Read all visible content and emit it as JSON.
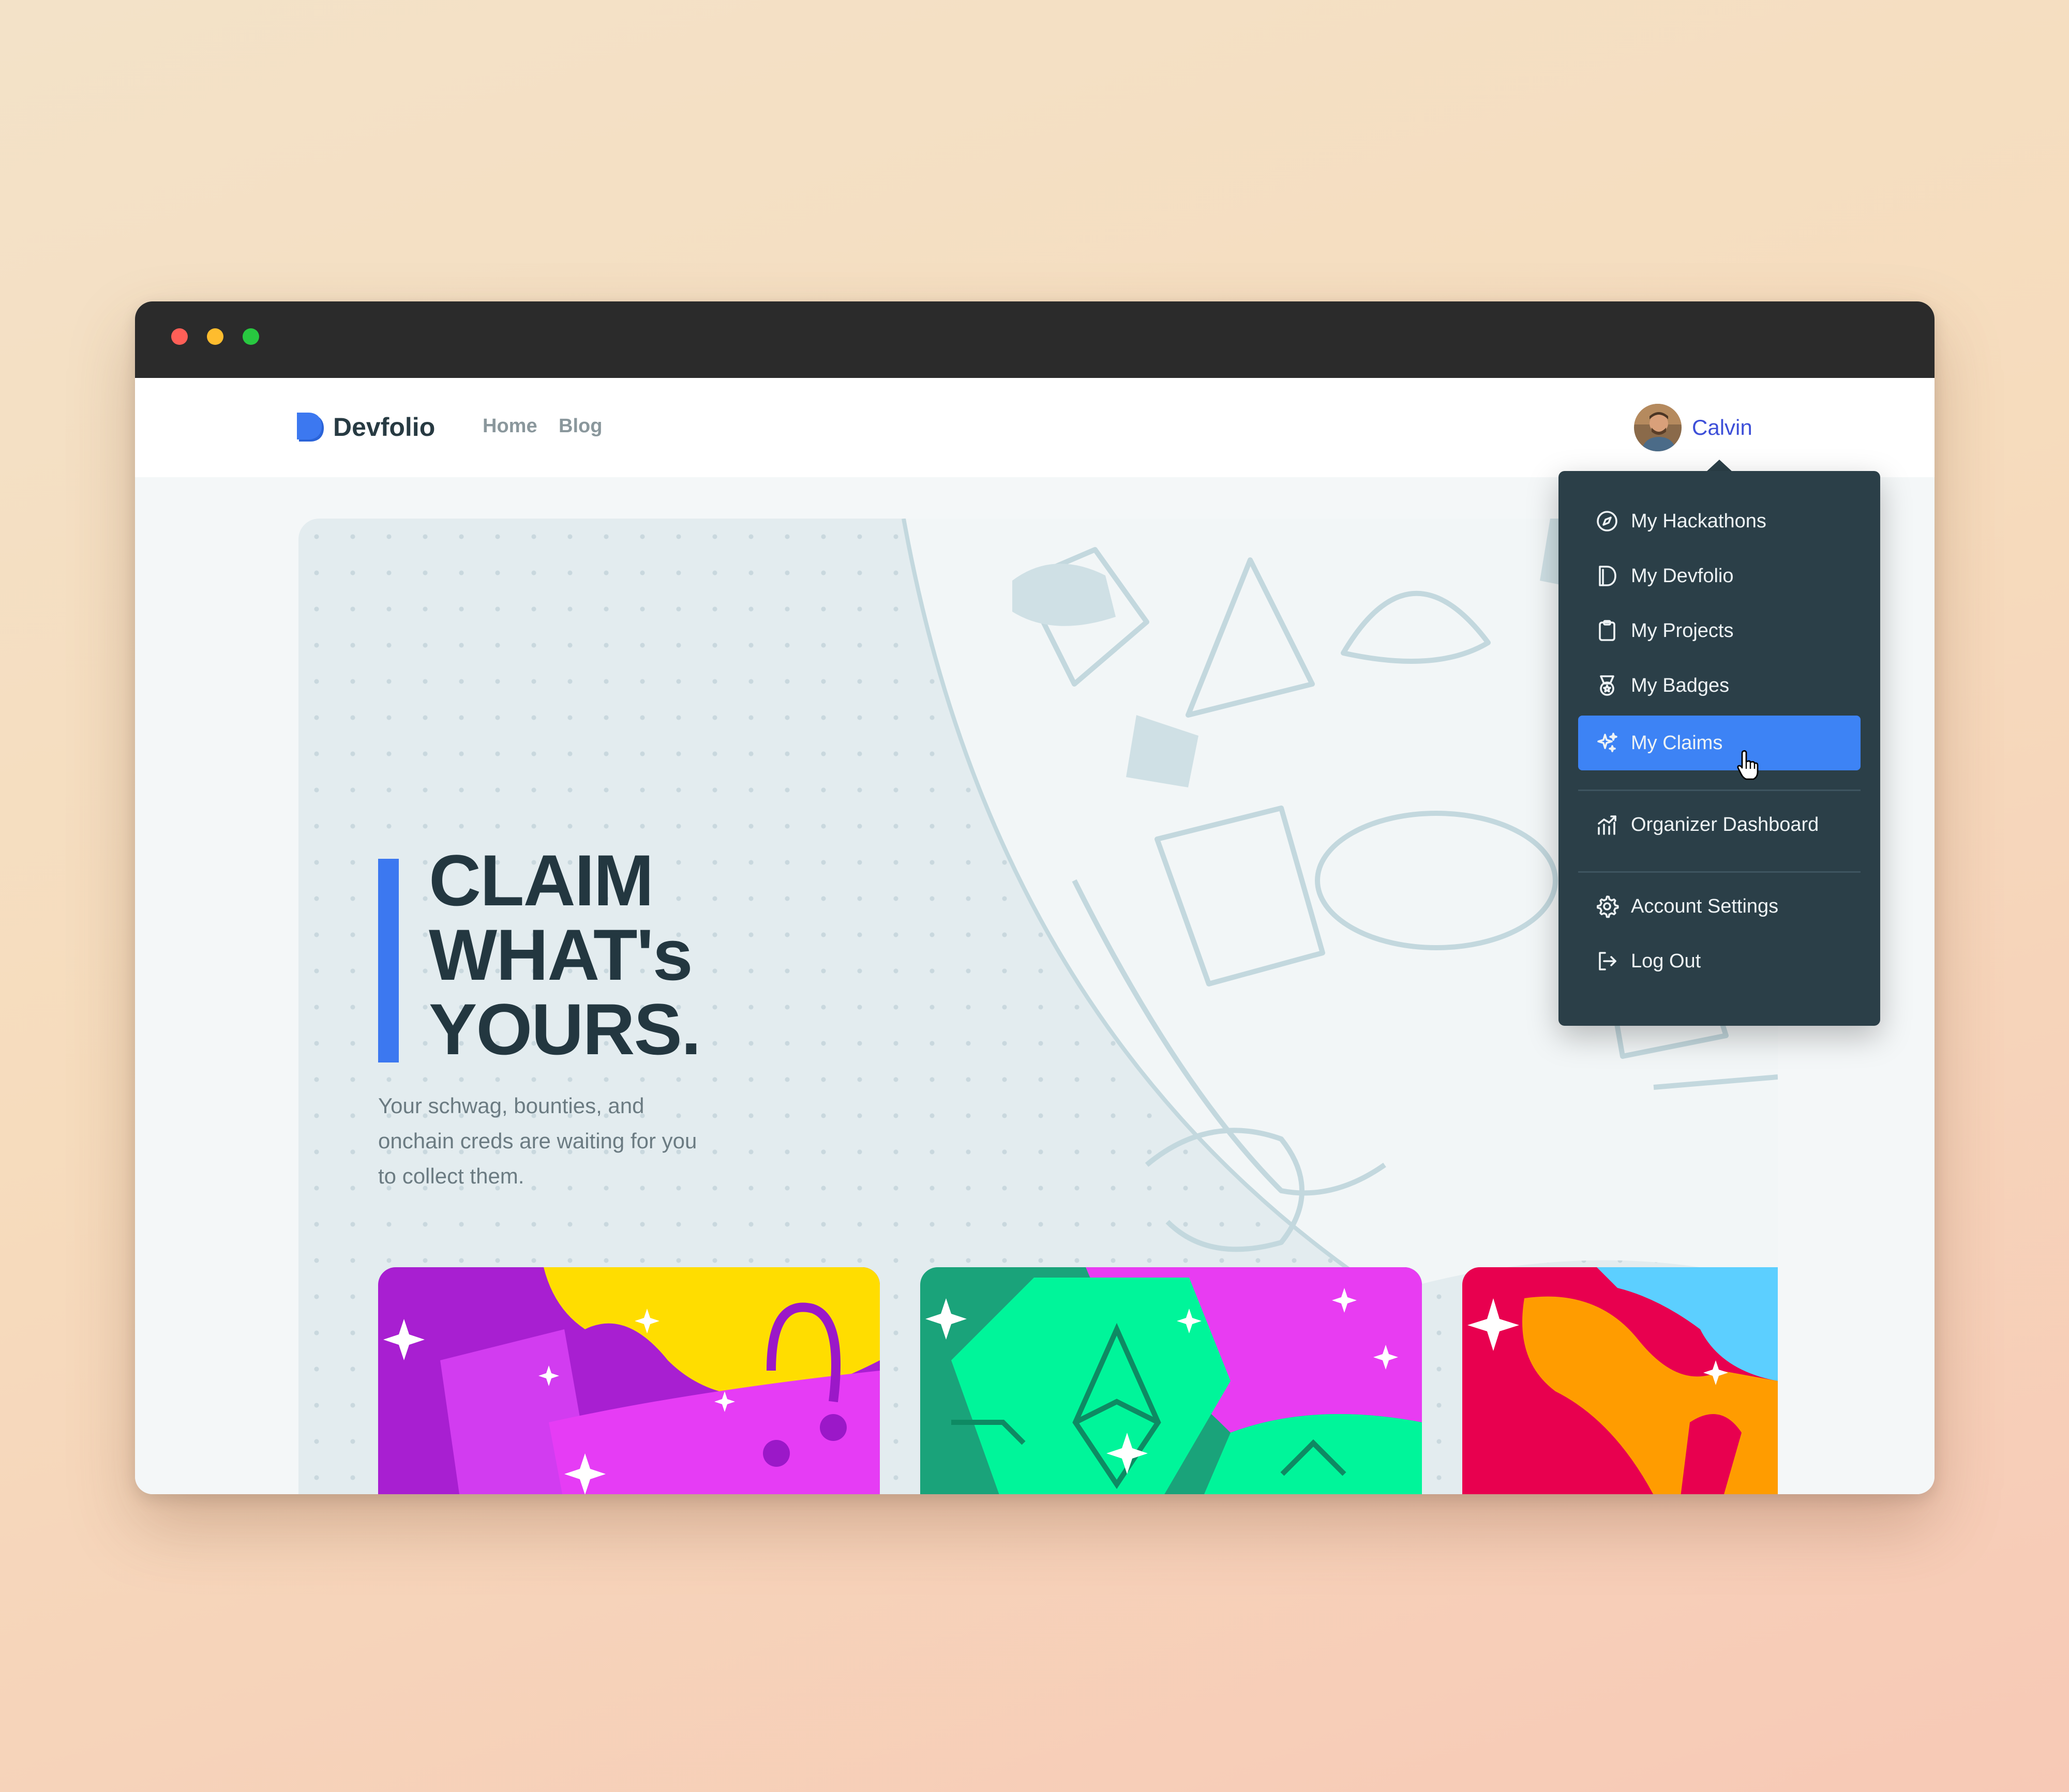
{
  "app": {
    "name": "Devfolio",
    "brand_color": "#3c78f0"
  },
  "nav": {
    "links": [
      {
        "label": "Home",
        "icon": null
      },
      {
        "label": "Blog",
        "icon": null
      }
    ]
  },
  "user": {
    "name": "Calvin",
    "avatar_icon": "avatar"
  },
  "hero": {
    "headline_lines": [
      "CLAIM",
      "WHAT's",
      "YOURS."
    ],
    "subtext": "Your schwag, bounties, and onchain creds are waiting for you to collect them.",
    "accent_color": "#3c78f0"
  },
  "cards": [
    {
      "icon": "shopping-bag-illustration",
      "colors": [
        "#a81fd1",
        "#ffdd00",
        "#e63cf5"
      ]
    },
    {
      "icon": "ethereum-circuit-illustration",
      "colors": [
        "#1aa37a",
        "#00f59a",
        "#e83cf2"
      ]
    },
    {
      "icon": "trophy-illustration",
      "colors": [
        "#e8004f",
        "#ff9c00",
        "#5ccfff"
      ]
    }
  ],
  "menu": {
    "items": [
      {
        "label": "My Hackathons",
        "icon": "compass-icon",
        "active": false
      },
      {
        "label": "My Devfolio",
        "icon": "devfolio-icon",
        "active": false
      },
      {
        "label": "My Projects",
        "icon": "clipboard-icon",
        "active": false
      },
      {
        "label": "My Badges",
        "icon": "medal-icon",
        "active": false
      },
      {
        "label": "My Claims",
        "icon": "sparkles-icon",
        "active": true
      },
      {
        "label": "Organizer Dashboard",
        "icon": "chart-icon",
        "active": false
      },
      {
        "label": "Account Settings",
        "icon": "gear-icon",
        "active": false
      },
      {
        "label": "Log Out",
        "icon": "logout-icon",
        "active": false
      }
    ],
    "background": "#2b3f48",
    "active_color": "#3d83f5"
  }
}
